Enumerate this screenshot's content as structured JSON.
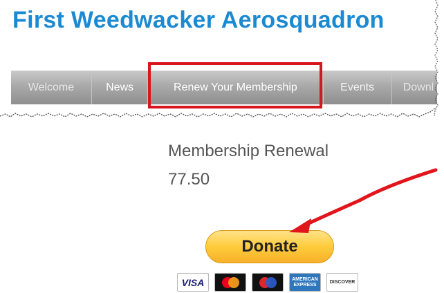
{
  "site": {
    "title": "First Weedwacker Aerosquadron"
  },
  "nav": {
    "items": [
      {
        "label": "Welcome"
      },
      {
        "label": "News"
      },
      {
        "label": "Renew Your Membership",
        "highlighted": true
      },
      {
        "label": "Events"
      },
      {
        "label": "Downl"
      }
    ]
  },
  "product": {
    "title": "Membership Renewal",
    "price": "77.50"
  },
  "donate": {
    "label": "Donate"
  },
  "payment_cards": [
    {
      "name": "visa",
      "label": "VISA"
    },
    {
      "name": "mastercard",
      "label": ""
    },
    {
      "name": "maestro",
      "label": ""
    },
    {
      "name": "american-express",
      "label": "AMERICAN EXPRESS"
    },
    {
      "name": "discover",
      "label": "DISCOVER"
    }
  ],
  "annotations": {
    "highlight_color": "#d8161e",
    "arrow_color": "#e0161c"
  }
}
